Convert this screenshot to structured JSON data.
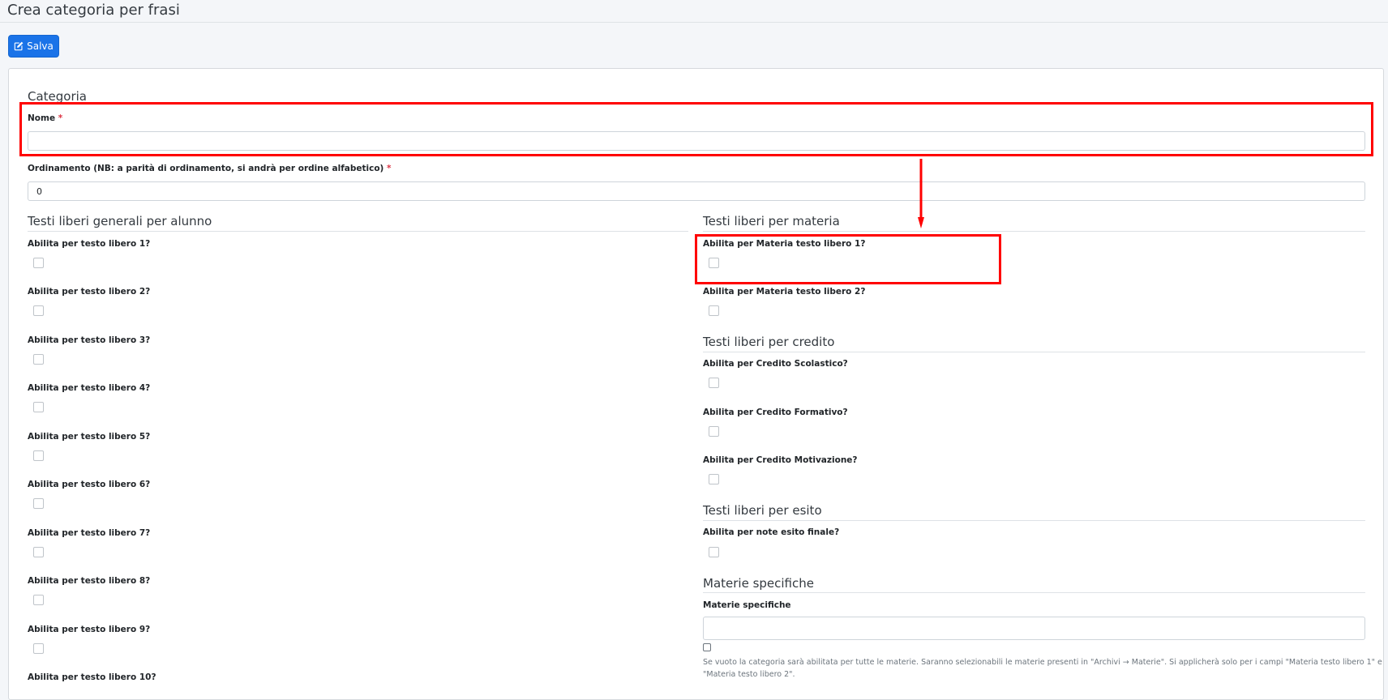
{
  "header": {
    "title": "Crea categoria per frasi"
  },
  "toolbar": {
    "save_label": "Salva"
  },
  "categoria": {
    "legend": "Categoria",
    "nome_label": "Nome",
    "required_mark": "*",
    "nome_value": "",
    "ordinamento_label": "Ordinamento (NB: a parità di ordinamento, si andrà per ordine alfabetico)",
    "ordinamento_value": "0"
  },
  "generali": {
    "legend": "Testi liberi generali per alunno",
    "items": [
      "Abilita per testo libero 1?",
      "Abilita per testo libero 2?",
      "Abilita per testo libero 3?",
      "Abilita per testo libero 4?",
      "Abilita per testo libero 5?",
      "Abilita per testo libero 6?",
      "Abilita per testo libero 7?",
      "Abilita per testo libero 8?",
      "Abilita per testo libero 9?",
      "Abilita per testo libero 10?"
    ]
  },
  "materia": {
    "legend": "Testi liberi per materia",
    "items": [
      "Abilita per Materia testo libero 1?",
      "Abilita per Materia testo libero 2?"
    ]
  },
  "credito": {
    "legend": "Testi liberi per credito",
    "items": [
      "Abilita per Credito Scolastico?",
      "Abilita per Credito Formativo?",
      "Abilita per Credito Motivazione?"
    ]
  },
  "esito": {
    "legend": "Testi liberi per esito",
    "items": [
      "Abilita per note esito finale?"
    ]
  },
  "materie_specifiche": {
    "legend": "Materie specifiche",
    "label": "Materie specifiche",
    "value": "",
    "help": "Se vuoto la categoria sarà abilitata per tutte le materie. Saranno selezionabili le materie presenti in \"Archivi → Materie\". Si applicherà solo per i campi \"Materia testo libero 1\" e \"Materia testo libero 2\"."
  },
  "colors": {
    "primary": "#1a73e8",
    "required": "#dc3545",
    "annotation": "#ff0000"
  },
  "icons": {
    "save": "edit-icon",
    "arrow": "arrow-down-icon"
  }
}
